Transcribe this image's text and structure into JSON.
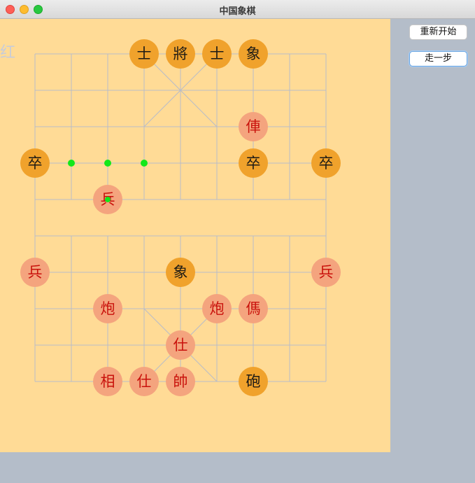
{
  "window": {
    "title": "中国象棋",
    "controls": [
      "close",
      "minimize",
      "zoom"
    ]
  },
  "board": {
    "turn_label": "红",
    "columns": 9,
    "rows": 10,
    "colors": {
      "background": "#ffdb96",
      "line": "#b8bcc8",
      "black_piece": "#f0a22c",
      "red_piece": "#f4a47e",
      "red_text": "#c9120c",
      "black_text": "#1e1b15",
      "move_hint": "#12e81a"
    },
    "pieces": [
      {
        "char": "士",
        "side": "black",
        "col": 3,
        "row": 0
      },
      {
        "char": "將",
        "side": "black",
        "col": 4,
        "row": 0
      },
      {
        "char": "士",
        "side": "black",
        "col": 5,
        "row": 0
      },
      {
        "char": "象",
        "side": "black",
        "col": 6,
        "row": 0
      },
      {
        "char": "俥",
        "side": "red",
        "col": 6,
        "row": 2
      },
      {
        "char": "卒",
        "side": "black",
        "col": 0,
        "row": 3
      },
      {
        "char": "卒",
        "side": "black",
        "col": 6,
        "row": 3
      },
      {
        "char": "卒",
        "side": "black",
        "col": 8,
        "row": 3
      },
      {
        "char": "兵",
        "side": "red",
        "col": 2,
        "row": 4
      },
      {
        "char": "兵",
        "side": "red",
        "col": 0,
        "row": 6
      },
      {
        "char": "象",
        "side": "black",
        "col": 4,
        "row": 6
      },
      {
        "char": "兵",
        "side": "red",
        "col": 8,
        "row": 6
      },
      {
        "char": "炮",
        "side": "red",
        "col": 2,
        "row": 7
      },
      {
        "char": "炮",
        "side": "red",
        "col": 5,
        "row": 7
      },
      {
        "char": "傌",
        "side": "red",
        "col": 6,
        "row": 7
      },
      {
        "char": "仕",
        "side": "red",
        "col": 4,
        "row": 8
      },
      {
        "char": "相",
        "side": "red",
        "col": 2,
        "row": 9
      },
      {
        "char": "仕",
        "side": "red",
        "col": 3,
        "row": 9
      },
      {
        "char": "帥",
        "side": "red",
        "col": 4,
        "row": 9
      },
      {
        "char": "砲",
        "side": "black",
        "col": 6,
        "row": 9
      }
    ],
    "move_hints": [
      {
        "col": 1,
        "row": 3
      },
      {
        "col": 2,
        "row": 3
      },
      {
        "col": 3,
        "row": 3
      },
      {
        "col": 2,
        "row": 4
      }
    ]
  },
  "controls": {
    "restart_label": "重新开始",
    "step_label": "走一步"
  }
}
